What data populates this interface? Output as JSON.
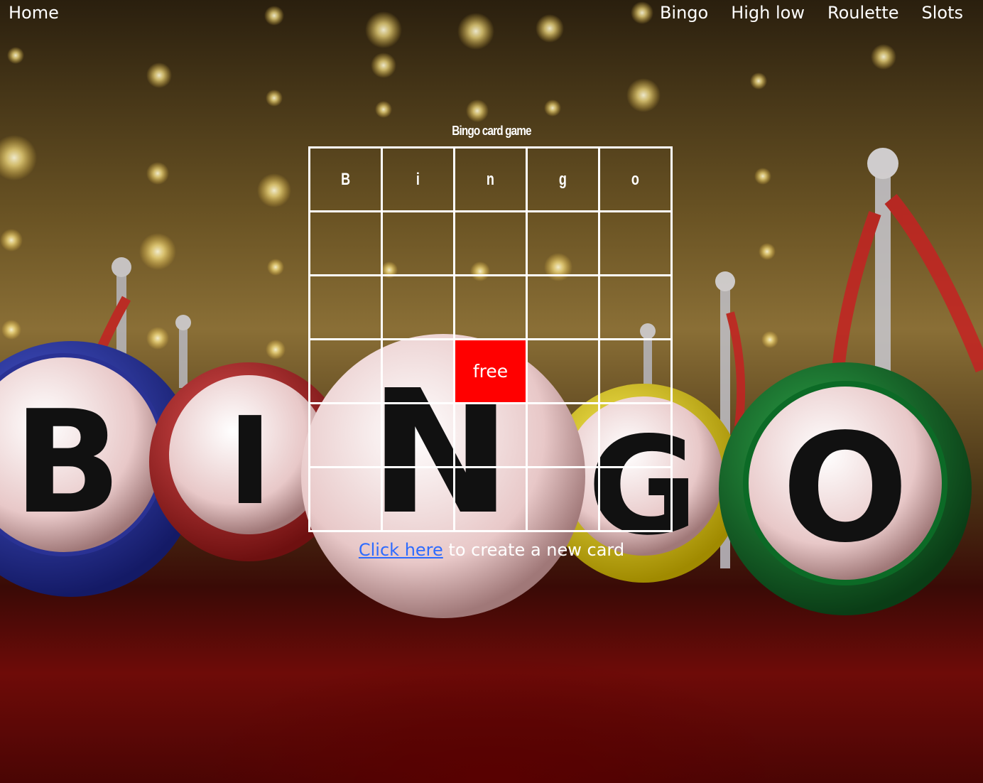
{
  "nav": {
    "home": "Home",
    "links": [
      "Bingo",
      "High low",
      "Roulette",
      "Slots"
    ]
  },
  "game": {
    "title": "Bingo card game",
    "headers": [
      "B",
      "i",
      "n",
      "g",
      "o"
    ],
    "free_label": "free",
    "free_color": "#ff0000"
  },
  "footer": {
    "link_text": "Click here",
    "rest_text": " to create a new card"
  }
}
